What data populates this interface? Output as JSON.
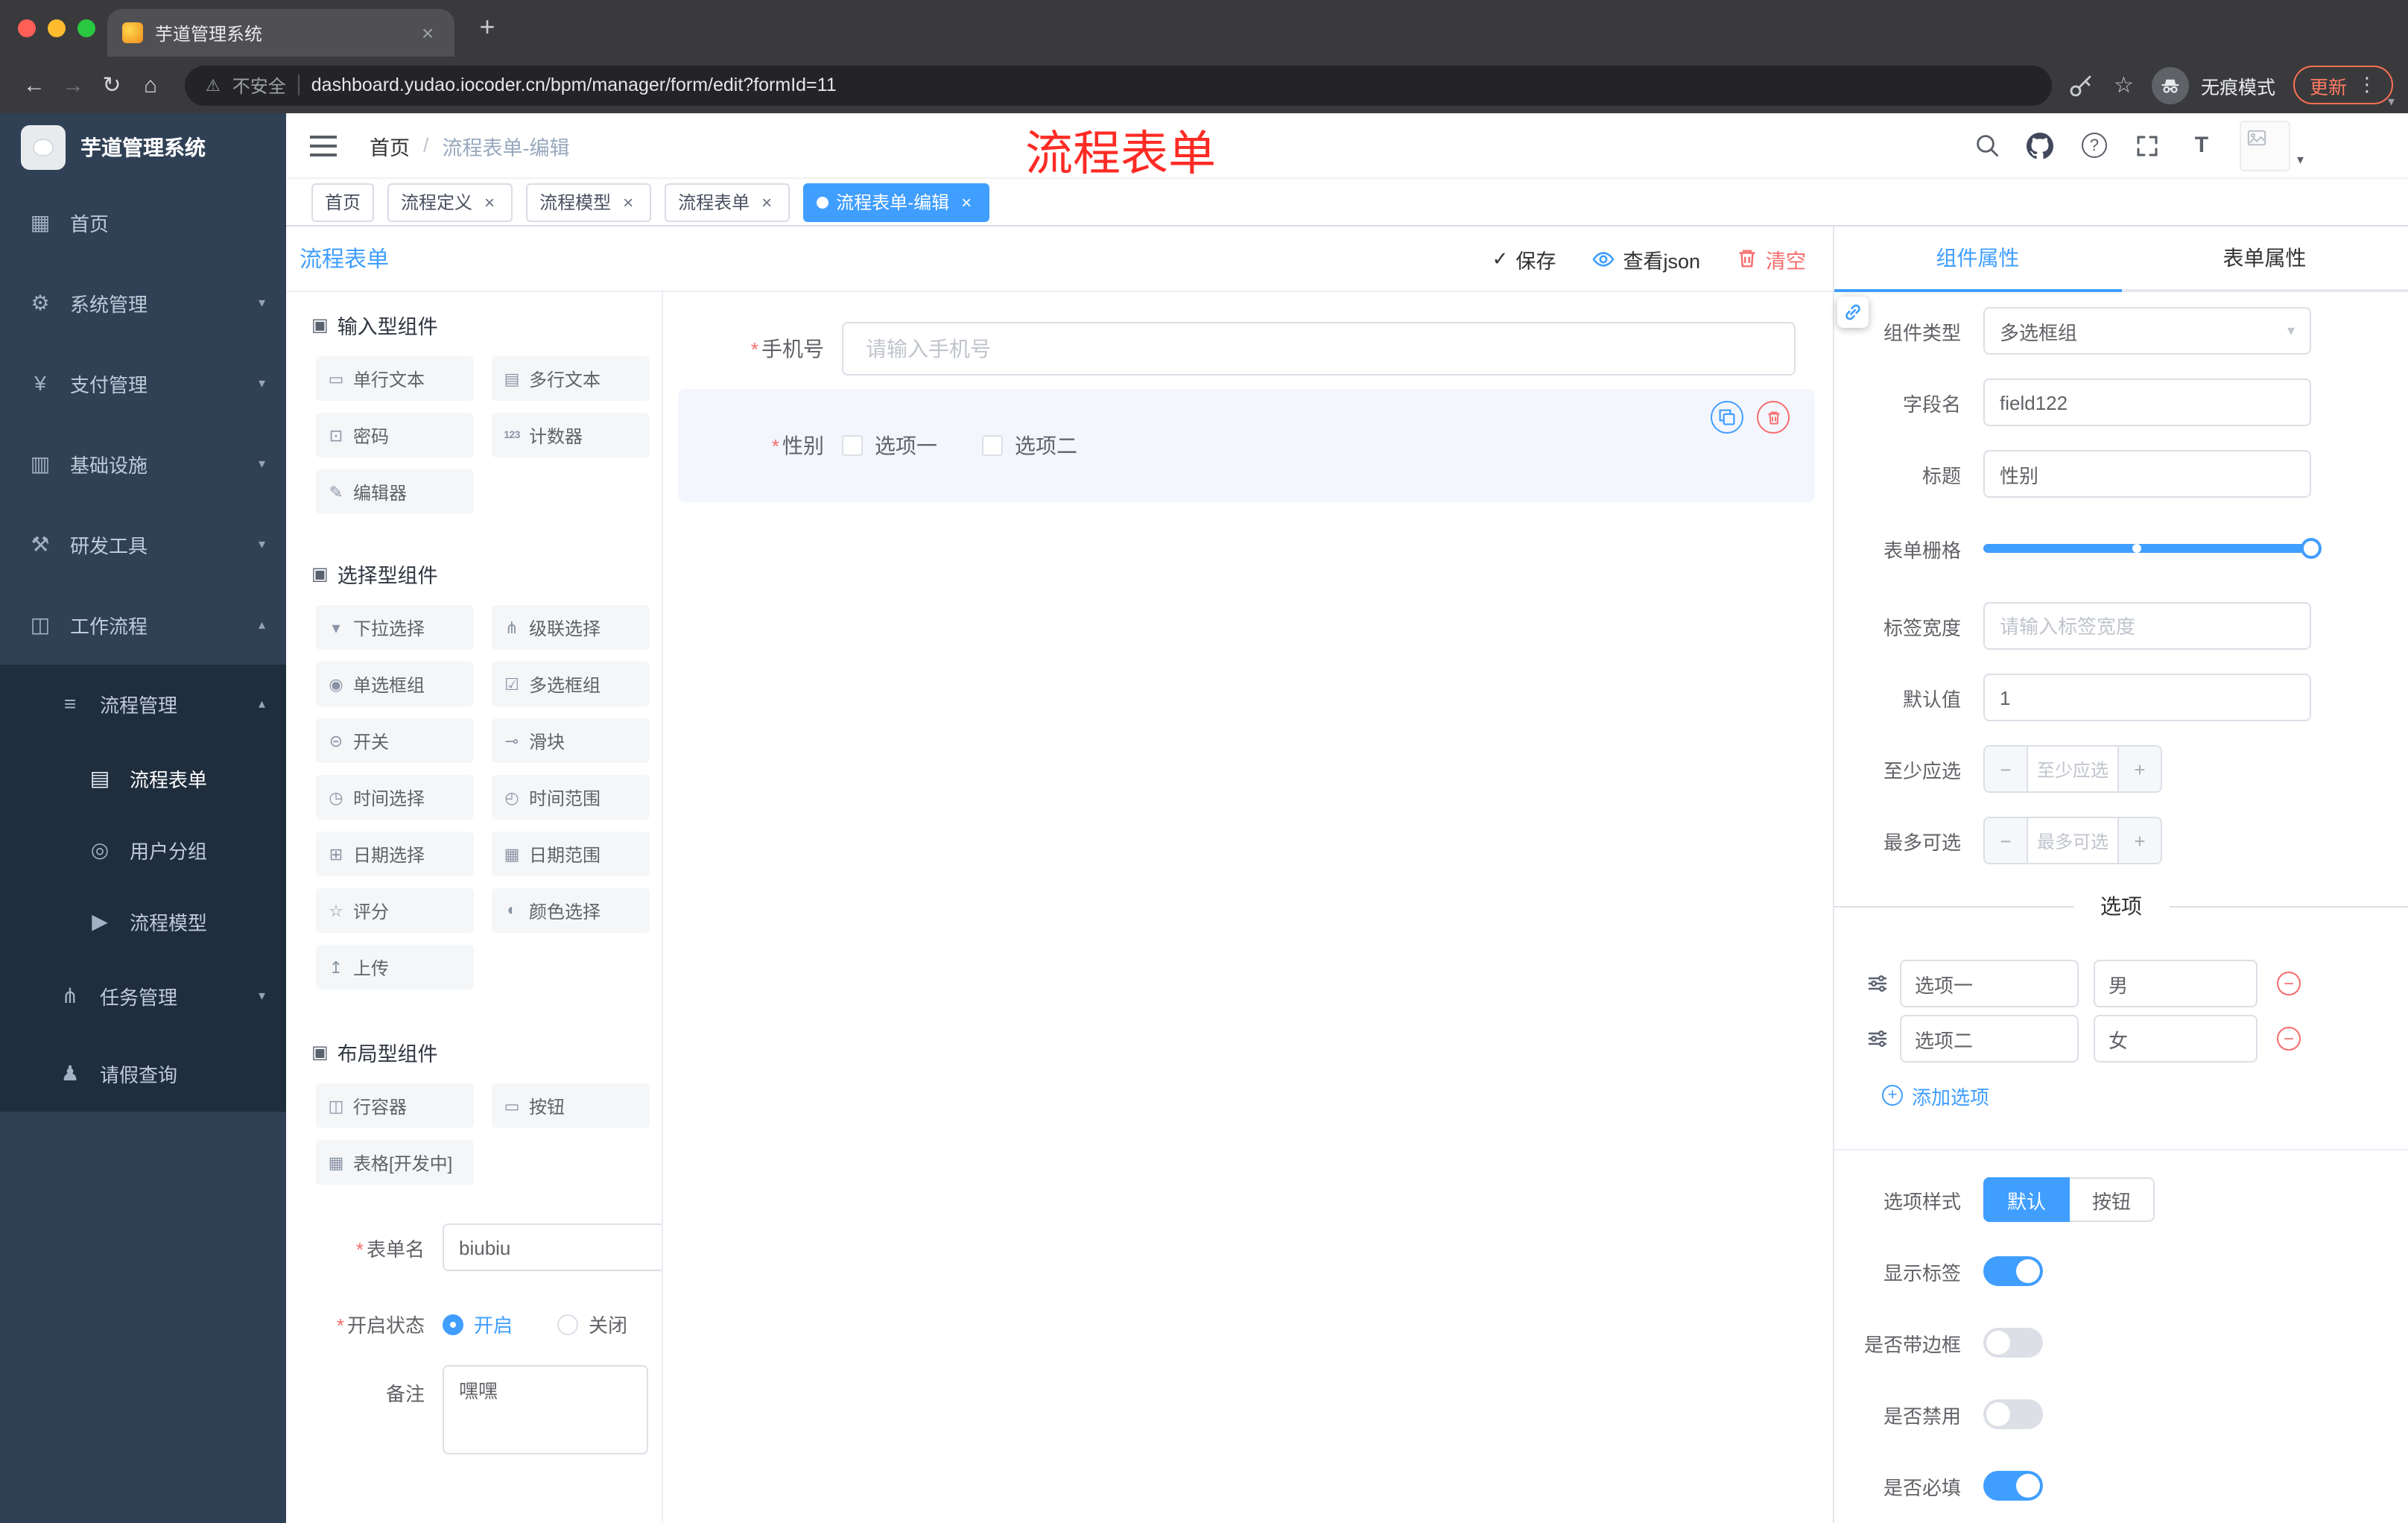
{
  "colors": {
    "accent": "#409eff",
    "danger": "#f56c6c",
    "sidebar-bg": "#304156",
    "submenu-bg": "#1f2d3d",
    "annotation": "#fe2b25"
  },
  "browser": {
    "tab_title": "芋道管理系统",
    "close": "×",
    "new_tab": "+",
    "back": "←",
    "forward": "→",
    "reload": "↻",
    "home": "⌂",
    "warning": "⚠",
    "security_label": "不安全",
    "url": "dashboard.yudao.iocoder.cn/bpm/manager/form/edit?formId=11",
    "star": "☆",
    "incognito_label": "无痕模式",
    "update_label": "更新",
    "kebab": "⋮",
    "caret": "▾"
  },
  "sidebar": {
    "logo_title": "芋道管理系统",
    "chevron_down": "▾",
    "chevron_up": "▴",
    "items": [
      {
        "label": "首页",
        "icon": "▦"
      },
      {
        "label": "系统管理",
        "icon": "⚙"
      },
      {
        "label": "支付管理",
        "icon": "¥"
      },
      {
        "label": "基础设施",
        "icon": "▥"
      },
      {
        "label": "研发工具",
        "icon": "⚒"
      },
      {
        "label": "工作流程",
        "icon": "◫"
      }
    ],
    "submenu": {
      "label": "流程管理",
      "icon": "≡",
      "items": [
        {
          "label": "流程表单",
          "icon": "▤"
        },
        {
          "label": "用户分组",
          "icon": "◎"
        },
        {
          "label": "流程模型",
          "icon": "▶"
        }
      ]
    },
    "tail_items": [
      {
        "label": "任务管理",
        "icon": "⋔"
      },
      {
        "label": "请假查询",
        "icon": "♟"
      }
    ]
  },
  "header": {
    "breadcrumb_home": "首页",
    "breadcrumb_sep": "/",
    "breadcrumb_current": "流程表单-编辑",
    "annotation": "流程表单",
    "question": "?",
    "font_icon": "T",
    "caret": "▾"
  },
  "tags": [
    {
      "label": "首页",
      "closable": false,
      "active": false
    },
    {
      "label": "流程定义",
      "closable": true,
      "active": false
    },
    {
      "label": "流程模型",
      "closable": true,
      "active": false
    },
    {
      "label": "流程表单",
      "closable": true,
      "active": false
    },
    {
      "label": "流程表单-编辑",
      "closable": true,
      "active": true
    }
  ],
  "close_glyph": "×",
  "editor": {
    "title": "流程表单",
    "check": "✓",
    "save_label": "保存",
    "view_json_label": "查看json",
    "clear_label": "清空"
  },
  "palette": {
    "sections": [
      {
        "title": "输入型组件",
        "icon": "▣",
        "items": [
          {
            "label": "单行文本",
            "icon": "▭"
          },
          {
            "label": "多行文本",
            "icon": "▤"
          },
          {
            "label": "密码",
            "icon": "⊡"
          },
          {
            "label": "计数器",
            "icon": "123"
          },
          {
            "label": "编辑器",
            "icon": "✎"
          }
        ]
      },
      {
        "title": "选择型组件",
        "icon": "▣",
        "items": [
          {
            "label": "下拉选择",
            "icon": "▾"
          },
          {
            "label": "级联选择",
            "icon": "⋔"
          },
          {
            "label": "单选框组",
            "icon": "◉"
          },
          {
            "label": "多选框组",
            "icon": "☑"
          },
          {
            "label": "开关",
            "icon": "⊝"
          },
          {
            "label": "滑块",
            "icon": "⊸"
          },
          {
            "label": "时间选择",
            "icon": "◷"
          },
          {
            "label": "时间范围",
            "icon": "◴"
          },
          {
            "label": "日期选择",
            "icon": "⊞"
          },
          {
            "label": "日期范围",
            "icon": "▦"
          },
          {
            "label": "评分",
            "icon": "☆"
          },
          {
            "label": "颜色选择",
            "icon": "◐"
          },
          {
            "label": "上传",
            "icon": "↥"
          }
        ]
      },
      {
        "title": "布局型组件",
        "icon": "▣",
        "items": [
          {
            "label": "行容器",
            "icon": "◫"
          },
          {
            "label": "按钮",
            "icon": "▭"
          },
          {
            "label": "表格[开发中]",
            "icon": "▦"
          }
        ]
      }
    ]
  },
  "form_meta": {
    "required_mark": "*",
    "name_label": "表单名",
    "name_value": "biubiu",
    "status_label": "开启状态",
    "status_on": "开启",
    "status_off": "关闭",
    "remark_label": "备注",
    "remark_value": "嘿嘿"
  },
  "canvas": {
    "phone_label": "手机号",
    "phone_placeholder": "请输入手机号",
    "gender_label": "性别",
    "gender_options": [
      "选项一",
      "选项二"
    ]
  },
  "props": {
    "tab_component": "组件属性",
    "tab_form": "表单属性",
    "component_type_label": "组件类型",
    "component_type_value": "多选框组",
    "select_caret": "▾",
    "field_name_label": "字段名",
    "field_name_value": "field122",
    "title_label": "标题",
    "title_value": "性别",
    "grid_label": "表单栅格",
    "label_width_label": "标签宽度",
    "label_width_placeholder": "请输入标签宽度",
    "default_label": "默认值",
    "default_value": "1",
    "min_label": "至少应选",
    "min_placeholder": "至少应选",
    "max_label": "最多可选",
    "max_placeholder": "最多可选",
    "minus": "−",
    "plus": "+",
    "options_title": "选项",
    "options": [
      {
        "label": "选项一",
        "value": "男"
      },
      {
        "label": "选项二",
        "value": "女"
      }
    ],
    "add_option_label": "添加选项",
    "option_style_label": "选项样式",
    "option_style_default": "默认",
    "option_style_button": "按钮",
    "switches": [
      {
        "label": "显示标签",
        "on": true
      },
      {
        "label": "是否带边框",
        "on": false
      },
      {
        "label": "是否禁用",
        "on": false
      },
      {
        "label": "是否必填",
        "on": true
      }
    ]
  }
}
